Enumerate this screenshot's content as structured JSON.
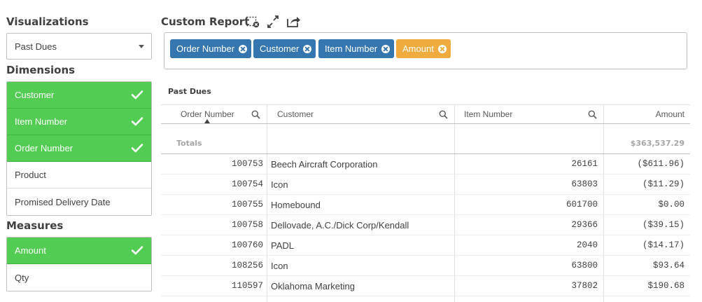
{
  "visualizations": {
    "title": "Visualizations",
    "selected": "Past Dues"
  },
  "dimensions": {
    "title": "Dimensions",
    "items": [
      {
        "label": "Customer",
        "selected": true
      },
      {
        "label": "Item Number",
        "selected": true
      },
      {
        "label": "Order Number",
        "selected": true
      },
      {
        "label": "Product",
        "selected": false
      },
      {
        "label": "Promised Delivery Date",
        "selected": false
      }
    ]
  },
  "measures": {
    "title": "Measures",
    "items": [
      {
        "label": "Amount",
        "selected": true
      },
      {
        "label": "Qty",
        "selected": false
      }
    ]
  },
  "report": {
    "title": "Custom Report",
    "icons": [
      "clear-selection-icon",
      "expand-icon",
      "export-icon"
    ]
  },
  "chips": [
    {
      "label": "Order Number",
      "color": "#3575b0"
    },
    {
      "label": "Customer",
      "color": "#3575b0"
    },
    {
      "label": "Item Number",
      "color": "#3575b0"
    },
    {
      "label": "Amount",
      "color": "#f0ab3f"
    }
  ],
  "table": {
    "title": "Past Dues",
    "columns": [
      "Order Number",
      "Customer",
      "Item Number",
      "Amount"
    ],
    "totals_label": "Totals",
    "totals_amount": "$363,537.29",
    "rows": [
      [
        "100753",
        "Beech Aircraft Corporation",
        "26161",
        "($611.96)"
      ],
      [
        "100754",
        "Icon",
        "63803",
        "($11.29)"
      ],
      [
        "100755",
        "Homebound",
        "601700",
        "$0.00"
      ],
      [
        "100758",
        "Dellovade, A.C./Dick Corp/Kendall",
        "29366",
        "($39.15)"
      ],
      [
        "100760",
        "PADL",
        "2040",
        "($14.17)"
      ],
      [
        "108256",
        "Icon",
        "63800",
        "$93.64"
      ],
      [
        "110597",
        "Oklahoma Marketing",
        "37802",
        "$190.68"
      ]
    ]
  },
  "colors": {
    "selected_green": "#52cc52",
    "chip_blue": "#3575b0",
    "chip_orange": "#f0ab3f"
  }
}
